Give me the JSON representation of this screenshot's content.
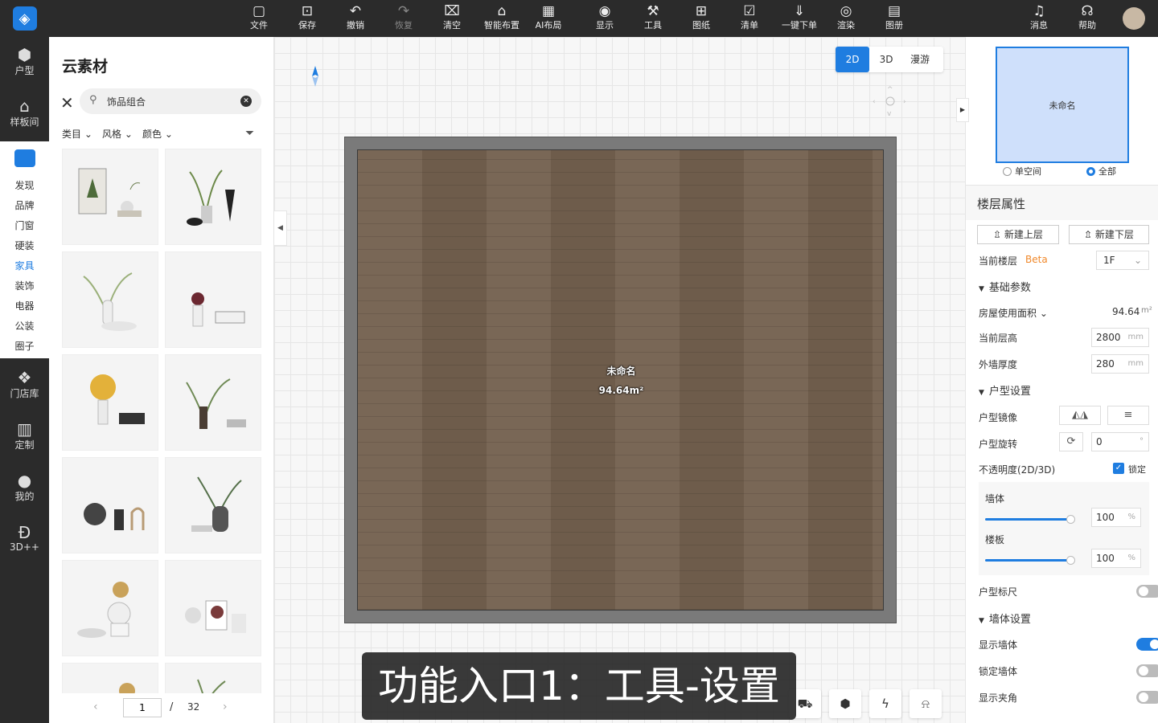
{
  "toolbar": {
    "items": [
      {
        "label": "文件",
        "icon": "file-icon"
      },
      {
        "label": "保存",
        "icon": "save-icon"
      },
      {
        "label": "撤销",
        "icon": "undo-icon"
      },
      {
        "label": "恢复",
        "icon": "redo-icon"
      },
      {
        "label": "清空",
        "icon": "trash-icon"
      },
      {
        "label": "智能布置",
        "icon": "home-icon"
      },
      {
        "label": "AI布局",
        "icon": "ai-layout-icon"
      },
      {
        "label": "显示",
        "icon": "eye-icon"
      },
      {
        "label": "工具",
        "icon": "wrench-icon"
      },
      {
        "label": "图纸",
        "icon": "map-icon"
      },
      {
        "label": "清单",
        "icon": "checklist-icon"
      },
      {
        "label": "一键下单",
        "icon": "order-icon"
      },
      {
        "label": "渲染",
        "icon": "camera-icon"
      },
      {
        "label": "图册",
        "icon": "album-icon"
      }
    ],
    "messages": "消息",
    "help": "帮助"
  },
  "leftnav": {
    "huxing": "户型",
    "yangbanjian": "样板间",
    "sub": [
      "发现",
      "品牌",
      "门窗",
      "硬装",
      "家具",
      "装饰",
      "电器",
      "公装",
      "圈子"
    ],
    "active_sub": "家具",
    "mendianku": "门店库",
    "dingzhi": "定制",
    "wode": "我的",
    "threed": "3D++"
  },
  "panel": {
    "title": "云素材",
    "search_value": "饰品组合",
    "filters": [
      "类目",
      "风格",
      "颜色"
    ],
    "page_current": "1",
    "page_slash": "/",
    "page_total": "32",
    "item_count_visible": 12
  },
  "canvas": {
    "view_modes": [
      "2D",
      "3D",
      "漫游"
    ],
    "active_view": "2D",
    "room_name": "未命名",
    "room_area": "94.64m²",
    "subtitle": "功能入口1：工具-设置"
  },
  "right": {
    "minimap_room": "未命名",
    "radio_single": "单空间",
    "radio_all": "全部",
    "floor_title": "楼层属性",
    "new_upper": "新建上层",
    "new_lower": "新建下层",
    "current_floor_label": "当前楼层",
    "beta": "Beta",
    "current_floor_value": "1F",
    "sec_basic": "基础参数",
    "area_label": "房屋使用面积",
    "area_value": "94.64",
    "area_unit": "m²",
    "height_label": "当前层高",
    "height_value": "2800",
    "thickness_label": "外墙厚度",
    "thickness_value": "280",
    "unit_mm": "mm",
    "sec_layout": "户型设置",
    "mirror_label": "户型镜像",
    "rotate_label": "户型旋转",
    "rotate_value": "0",
    "rotate_unit": "°",
    "opacity_label": "不透明度(2D/3D)",
    "lock_label": "锁定",
    "wall_label": "墙体",
    "wall_value": "100",
    "slab_label": "楼板",
    "slab_value": "100",
    "percent": "%",
    "ruler_label": "户型标尺",
    "sec_wall": "墙体设置",
    "show_wall": "显示墙体",
    "lock_wall": "锁定墙体",
    "show_angle": "显示夹角"
  },
  "colors": {
    "accent": "#1f7de0",
    "topbar": "#2b2b2b",
    "beta": "#f0882a"
  }
}
